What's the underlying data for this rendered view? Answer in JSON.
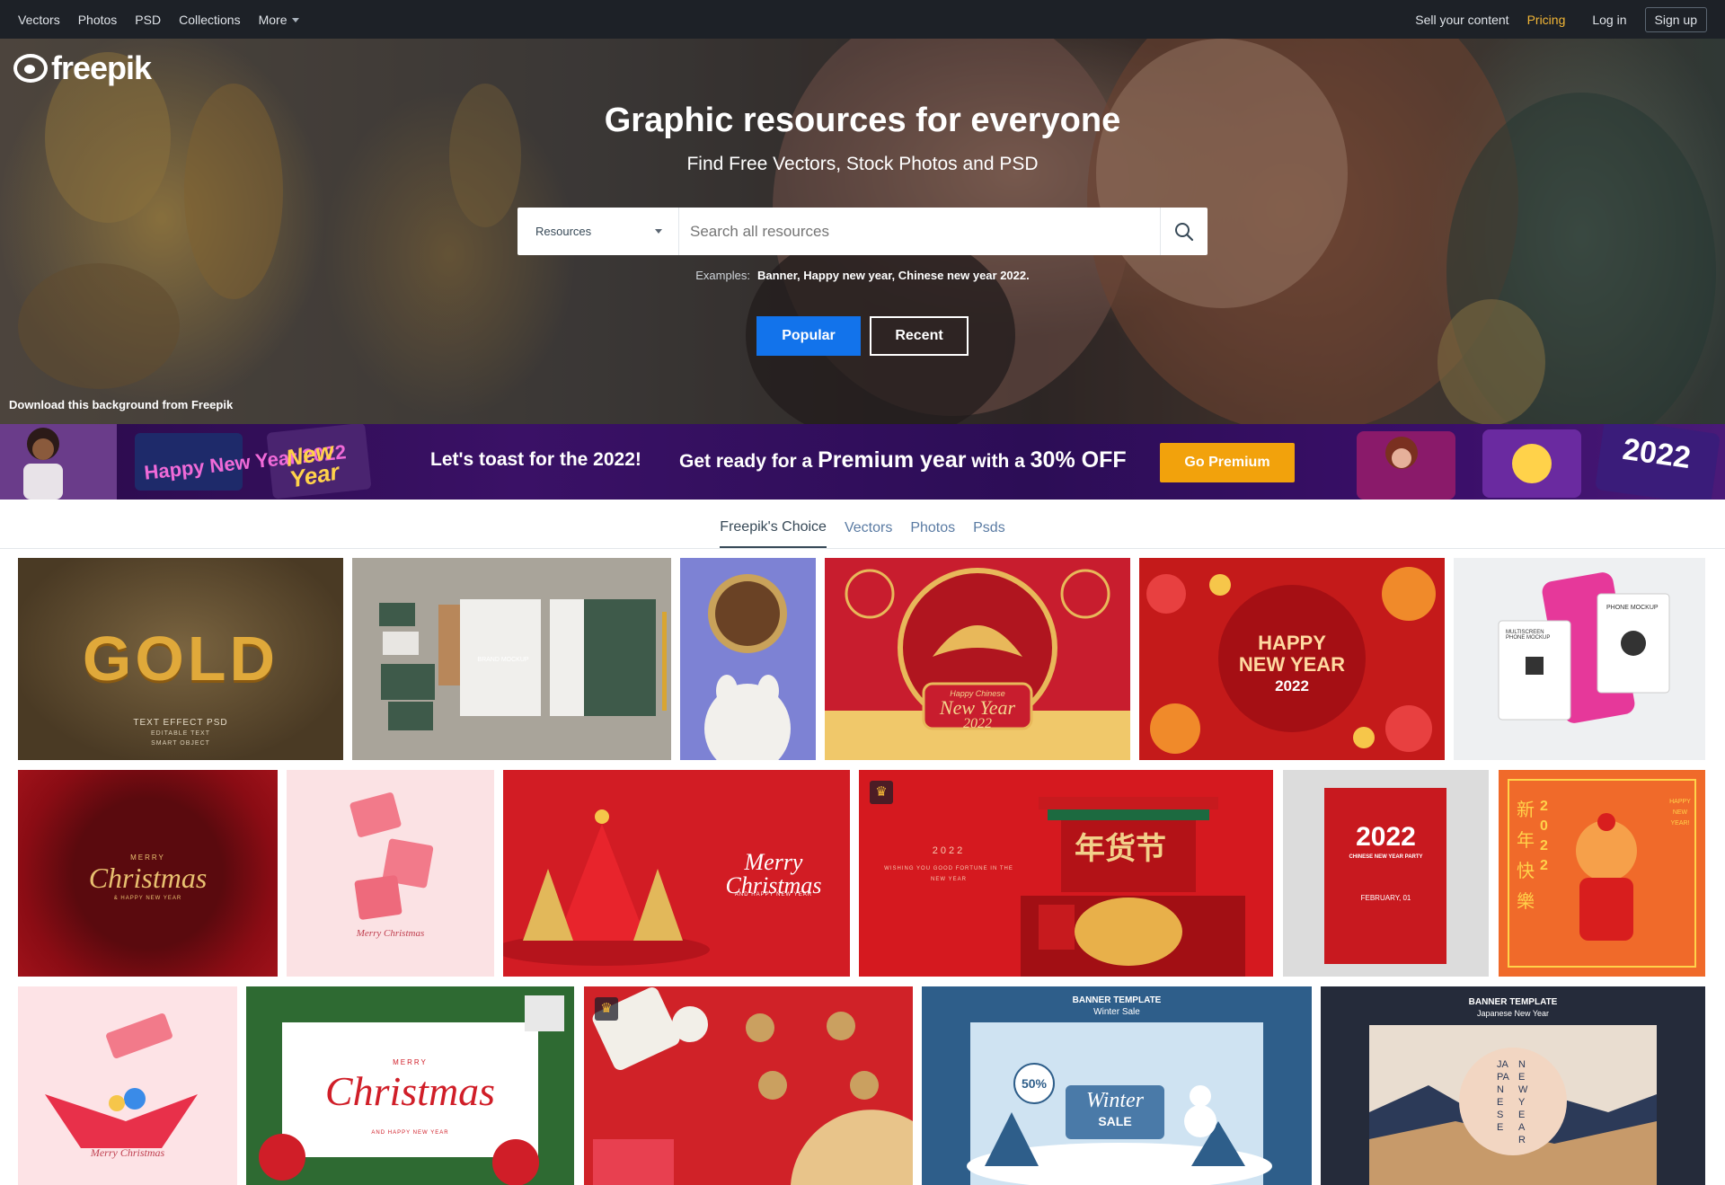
{
  "topnav": {
    "left": [
      {
        "label": "Vectors"
      },
      {
        "label": "Photos"
      },
      {
        "label": "PSD"
      },
      {
        "label": "Collections"
      },
      {
        "label": "More"
      }
    ],
    "right": {
      "sell": "Sell your content",
      "pricing": "Pricing",
      "login": "Log in",
      "signup": "Sign up"
    }
  },
  "hero": {
    "logo": "freepik",
    "title": "Graphic resources for everyone",
    "subtitle": "Find Free Vectors, Stock Photos and PSD",
    "search": {
      "type_selected": "Resources",
      "placeholder": "Search all resources"
    },
    "examples_label": "Examples:",
    "examples": "Banner, Happy new year, Chinese new year 2022.",
    "buttons": {
      "popular": "Popular",
      "recent": "Recent"
    },
    "credit": "Download this background from Freepik"
  },
  "promo": {
    "toast": "Let's toast for the 2022!",
    "offer_pre": "Get ready for a",
    "offer_big1": "Premium year",
    "offer_mid": "with a",
    "offer_big2": "30% OFF",
    "cta": "Go Premium",
    "art_left_1": "Happy New Year 2022",
    "art_left_2": "New Year",
    "art_right": "2022"
  },
  "tabs": [
    {
      "label": "Freepik's Choice",
      "active": true
    },
    {
      "label": "Vectors"
    },
    {
      "label": "Photos"
    },
    {
      "label": "Psds"
    }
  ],
  "gallery": {
    "gold": {
      "title": "GOLD",
      "line1": "TEXT EFFECT PSD",
      "line2": "EDITABLE TEXT",
      "line3": "SMART OBJECT"
    },
    "brand": "BRAND MOCKUP",
    "cny_tiger": {
      "script": "Happy Chinese",
      "big": "New Year",
      "year": "2022"
    },
    "happy_ny": {
      "l1": "HAPPY",
      "l2": "NEW YEAR",
      "l3": "2022"
    },
    "phone": {
      "a": "PHONE MOCKUP",
      "b": "MULTISCREEN PHONE MOCKUP"
    },
    "xmas_gold": {
      "top": "MERRY",
      "big": "Christmas",
      "bottom": "& HAPPY NEW YEAR"
    },
    "gifts_pink": "Merry Christmas",
    "xmas_tree": {
      "big": "Merry Christmas",
      "small": "AND HAPPY NEW YEAR"
    },
    "cny_gate": {
      "year": "2022",
      "wish": "WISHING YOU GOOD FORTUNE IN THE NEW YEAR",
      "sign": "年货节"
    },
    "poster_2022": {
      "year": "2022",
      "sub": "CHINESE NEW YEAR PARTY",
      "date": "FEBRUARY, 01"
    },
    "tiger_card": {
      "cn": "新年快樂",
      "num": "2022",
      "en": "HAPPY NEW YEAR!"
    },
    "gift_open": "Merry Christmas",
    "xmas_wreath": {
      "top": "MERRY",
      "big": "Christmas",
      "bottom": "AND HAPPY NEW YEAR"
    },
    "winter": {
      "head": "BANNER TEMPLATE",
      "sub": "Winter Sale",
      "badge": "50%",
      "big": "Winter",
      "sale": "SALE"
    },
    "japanese": {
      "head": "BANNER TEMPLATE",
      "sub": "Japanese New Year",
      "v1": "JAPANESE",
      "v2": "NEW YEAR"
    }
  },
  "colors": {
    "accent": "#1273eb",
    "pricing": "#f2b636",
    "premium": "#f2a20c",
    "topbar": "#1d2127"
  }
}
